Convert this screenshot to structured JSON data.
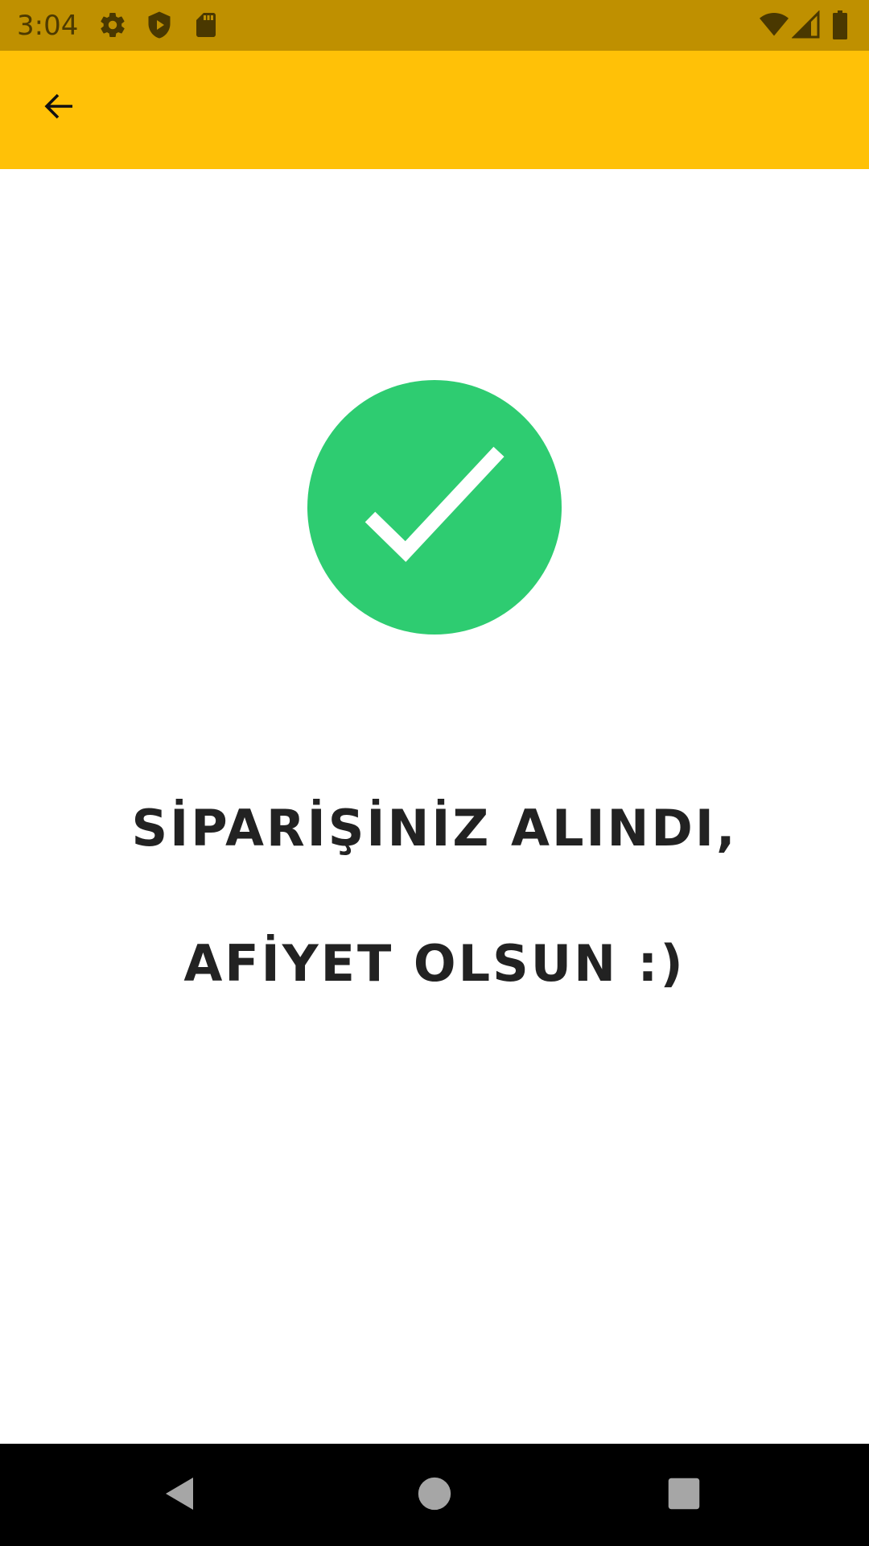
{
  "status_bar": {
    "time": "3:04",
    "left_icons": [
      "gear-icon",
      "shield-play-icon",
      "sd-card-icon"
    ],
    "right_icons": [
      "wifi-icon",
      "cell-signal-icon",
      "battery-icon"
    ]
  },
  "app_bar": {
    "back_icon": "arrow-left-icon",
    "color": "#ffc107"
  },
  "success": {
    "icon": "check-icon",
    "circle_color": "#2ecc71",
    "line1": "SİPARİŞİNİZ ALINDI,",
    "line2": "AFİYET OLSUN :)"
  },
  "nav_bar": {
    "buttons": [
      "back-triangle-icon",
      "home-circle-icon",
      "recents-square-icon"
    ]
  }
}
